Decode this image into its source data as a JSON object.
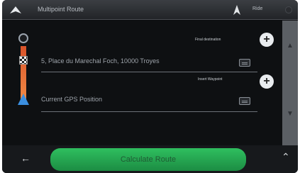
{
  "header": {
    "title": "Multipoint Route",
    "status": "Ride"
  },
  "route": {
    "destination_label": "5, Place du Marechal Foch, 10000 Troyes",
    "start_label": "Current GPS Position",
    "set_destination_label": "Final destination",
    "insert_waypoint_label": "Insert Waypoint"
  },
  "footer": {
    "calculate_label": "Calculate Route"
  },
  "colors": {
    "route_line": "#f08a45",
    "calculate_button": "#2fbf5f",
    "gps_arrow": "#3b8fe0"
  },
  "icons": {
    "back": "back-arrow-icon",
    "gps": "gps-icon",
    "plus": "plus-icon",
    "info": "info-box-icon",
    "scroll_up": "scroll-up-icon",
    "scroll_down": "scroll-down-icon",
    "chevron_up": "chevron-up-icon"
  }
}
